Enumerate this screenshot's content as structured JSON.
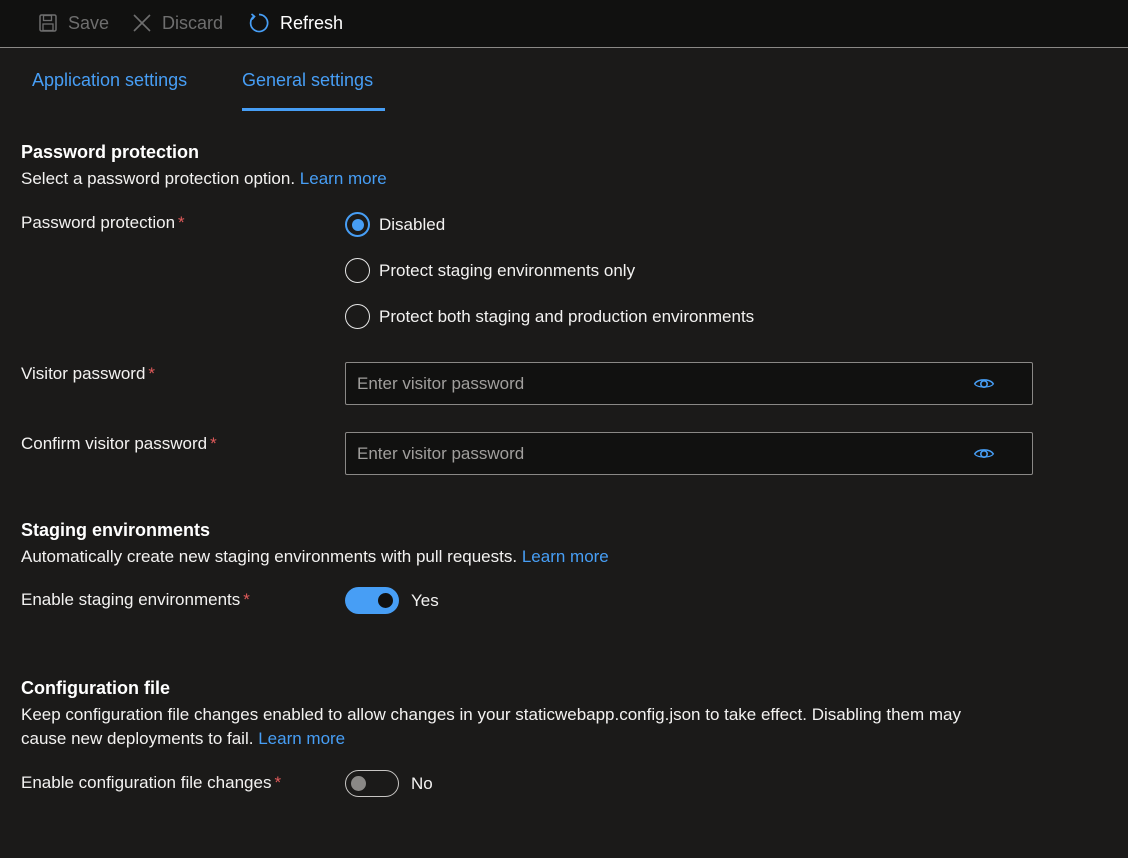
{
  "toolbar": {
    "save_label": "Save",
    "discard_label": "Discard",
    "refresh_label": "Refresh"
  },
  "tabs": [
    {
      "label": "Application settings",
      "selected": false
    },
    {
      "label": "General settings",
      "selected": true
    }
  ],
  "password_section": {
    "title": "Password protection",
    "description": "Select a password protection option.",
    "learn_more": "Learn more",
    "field_label": "Password protection",
    "required_mark": "*",
    "options": [
      {
        "label": "Disabled",
        "checked": true
      },
      {
        "label": "Protect staging environments only",
        "checked": false
      },
      {
        "label": "Protect both staging and production environments",
        "checked": false
      }
    ],
    "visitor_password": {
      "label": "Visitor password",
      "placeholder": "Enter visitor password",
      "value": ""
    },
    "confirm_password": {
      "label": "Confirm visitor password",
      "placeholder": "Enter visitor password",
      "value": ""
    }
  },
  "staging_section": {
    "title": "Staging environments",
    "description": "Automatically create new staging environments with pull requests.",
    "learn_more": "Learn more",
    "field_label": "Enable staging environments",
    "toggle_on": true,
    "toggle_text": "Yes"
  },
  "config_section": {
    "title": "Configuration file",
    "description_line1": "Keep configuration file changes enabled to allow changes in your staticwebapp.config.json to take effect. Disabling them may",
    "description_line2": "cause new deployments to fail.",
    "learn_more": "Learn more",
    "field_label": "Enable configuration file changes",
    "toggle_on": false,
    "toggle_text": "No"
  },
  "icons": {
    "save": "save-icon",
    "discard": "close-icon",
    "refresh": "refresh-icon",
    "reveal": "eye-icon"
  },
  "colors": {
    "accent": "#479ef5",
    "background": "#1b1a19",
    "toolbar": "#111110",
    "required": "#e05a5a"
  }
}
